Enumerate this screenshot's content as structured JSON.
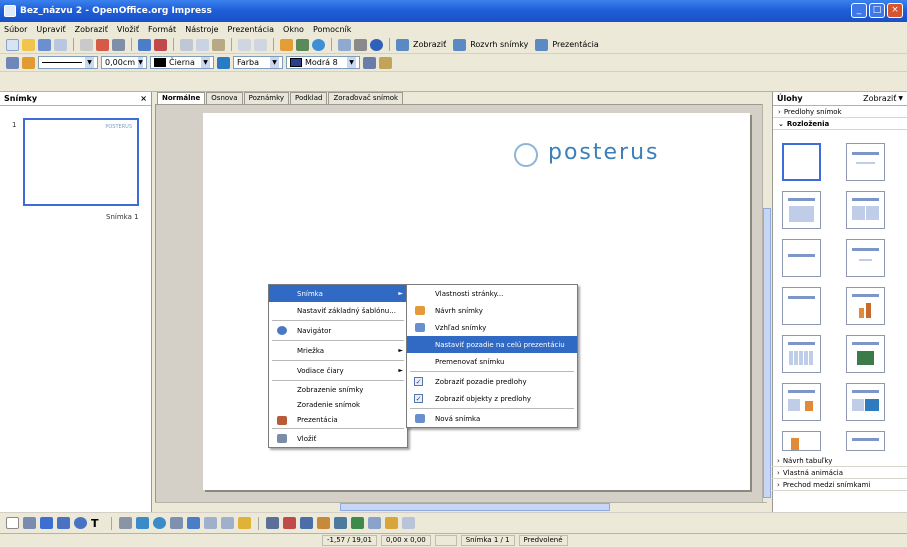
{
  "window": {
    "title": "Bez_názvu 2 - OpenOffice.org Impress",
    "min": "_",
    "max": "□",
    "close": "×"
  },
  "menubar": [
    "Súbor",
    "Upraviť",
    "Zobraziť",
    "Vložiť",
    "Formát",
    "Nástroje",
    "Prezentácia",
    "Okno",
    "Pomocník"
  ],
  "toolbar1": {
    "show_label": "Zobraziť",
    "outline_label": "Rozvrh snímky",
    "present_label": "Prezentácia"
  },
  "toolbar2": {
    "line_width": "0,00cm",
    "line_color": "Čierna",
    "area_style": "Farba",
    "area_color": "Modrá 8"
  },
  "slides_panel": {
    "title": "Snímky",
    "close": "×",
    "slide_number": "1",
    "slide_name": "Snímka 1",
    "thumb_caption": "POSTERUS"
  },
  "view_tabs": [
    "Normálne",
    "Osnova",
    "Poznámky",
    "Podklad",
    "Zoraďovač snímok"
  ],
  "slide": {
    "logo_text": "posterus"
  },
  "context_menu": {
    "items": [
      {
        "label": "Snímka",
        "selected": true,
        "submenu": true
      },
      {
        "label": "Nastaviť základný šablónu..."
      },
      {
        "sep": true
      },
      {
        "label": "Navigátor",
        "icon": true
      },
      {
        "sep": true
      },
      {
        "label": "Mriežka",
        "submenu": true
      },
      {
        "sep": true
      },
      {
        "label": "Vodiace čiary",
        "submenu": true
      },
      {
        "sep": true
      },
      {
        "label": "Zobrazenie snímky"
      },
      {
        "label": "Zoradenie snímok"
      },
      {
        "label": "Prezentácia",
        "icon": true
      },
      {
        "sep": true
      },
      {
        "label": "Vložiť",
        "icon": true
      }
    ]
  },
  "submenu": {
    "items": [
      {
        "label": "Vlastnosti stránky..."
      },
      {
        "label": "Návrh snímky",
        "icon": true
      },
      {
        "label": "Vzhľad snímky",
        "icon": true
      },
      {
        "label": "Nastaviť pozadie na celú prezentáciu",
        "selected": true
      },
      {
        "label": "Premenovať snímku"
      },
      {
        "sep": true
      },
      {
        "label": "Zobraziť pozadie predlohy",
        "check": true
      },
      {
        "label": "Zobraziť objekty z predlohy",
        "check": true
      },
      {
        "sep": true
      },
      {
        "label": "Nová snímka",
        "icon": true
      }
    ]
  },
  "task_pane": {
    "title": "Úlohy",
    "view_label": "Zobraziť",
    "sections_top": [
      "Predlohy snímok",
      "Rozloženia"
    ],
    "sections_bottom": [
      "Návrh tabuľky",
      "Vlastná animácia",
      "Prechod medzi snímkami"
    ]
  },
  "status": {
    "position": "-1,57 / 19,01",
    "size": "0,00 x 0,00",
    "zoom": "",
    "slide": "Snímka 1 / 1",
    "layout": "Predvolené"
  },
  "colors": {
    "titlebar": "#1f5fd8",
    "selection": "#316ac5",
    "logo": "#3d7fb8"
  }
}
